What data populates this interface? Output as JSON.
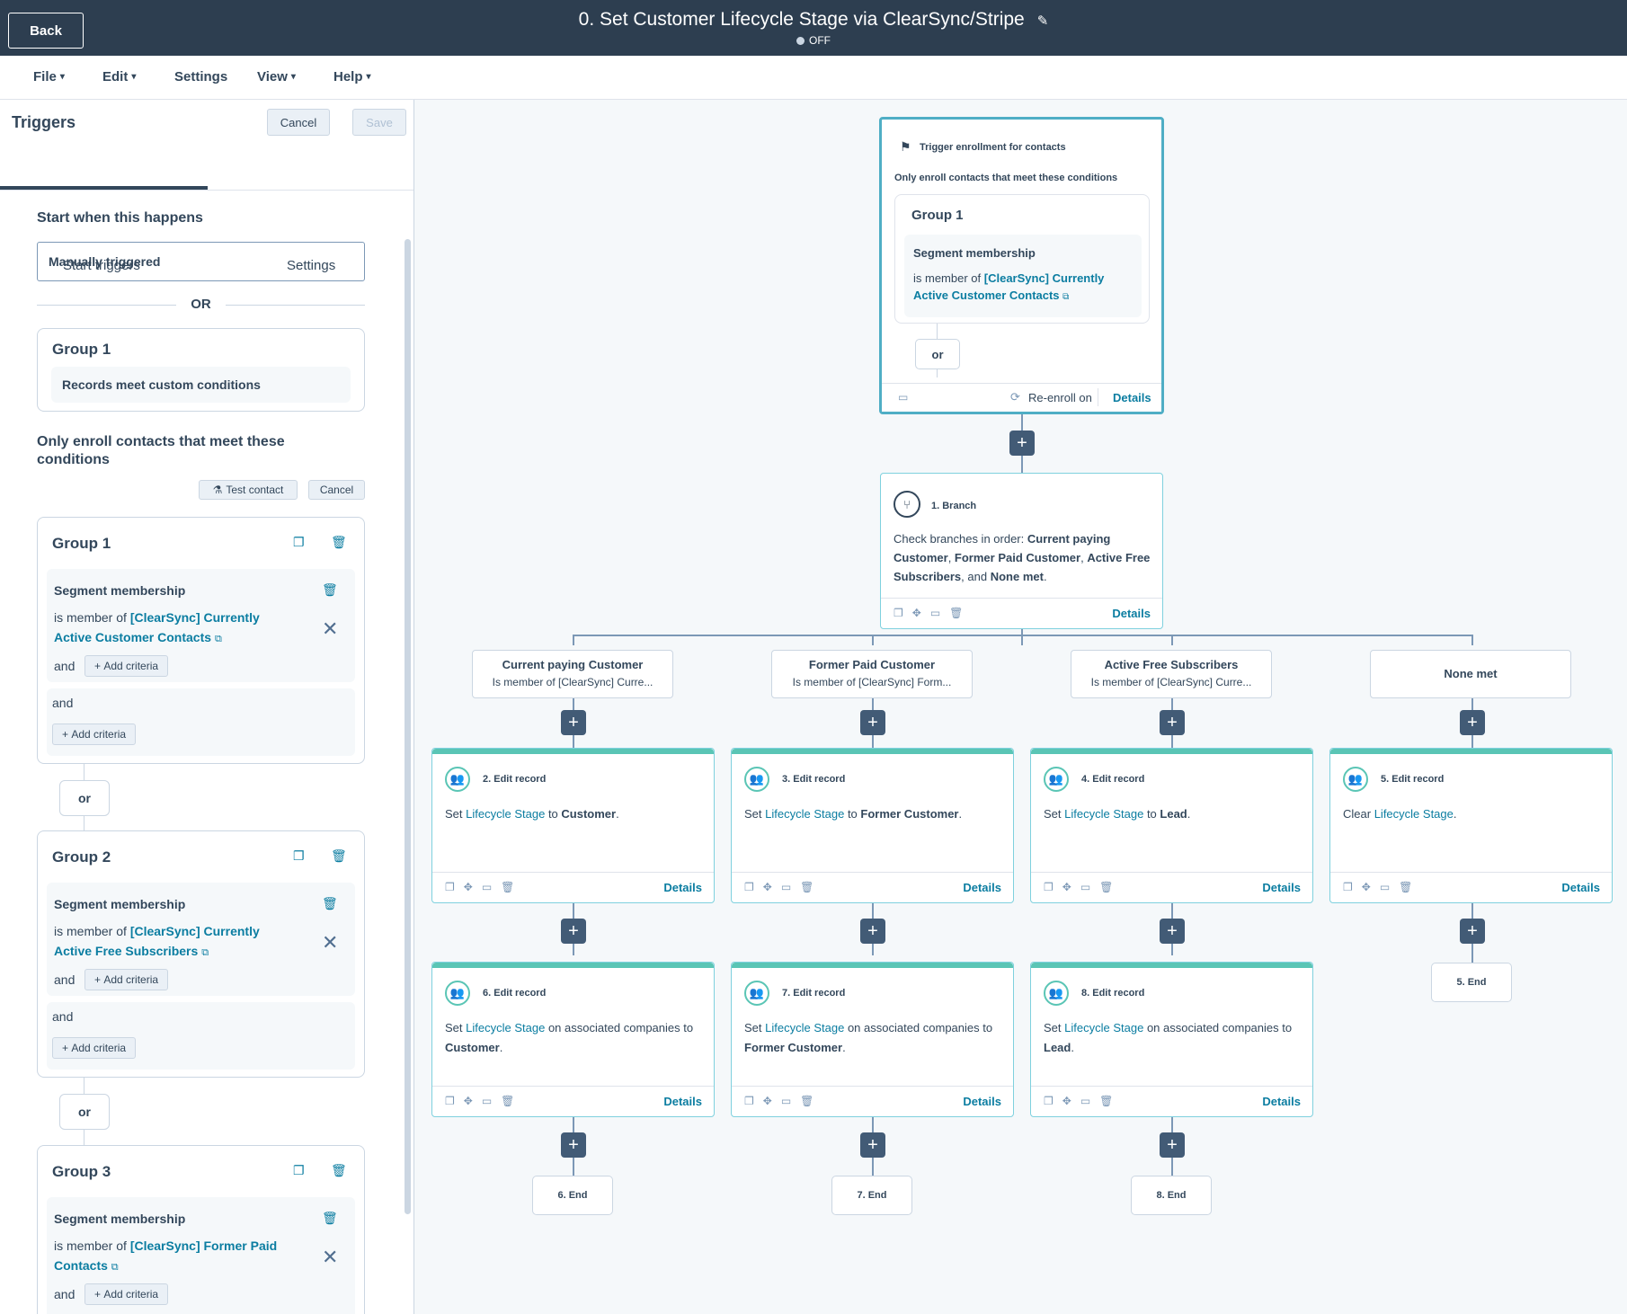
{
  "header": {
    "back_label": "Back",
    "title": "0. Set Customer Lifecycle Stage via ClearSync/Stripe",
    "status": "OFF"
  },
  "menu": {
    "file": "File",
    "edit": "Edit",
    "settings": "Settings",
    "view": "View",
    "help": "Help"
  },
  "left_panel": {
    "title": "Triggers",
    "cancel": "Cancel",
    "save": "Save",
    "tabs": [
      "Start triggers",
      "Settings"
    ],
    "start_when": "Start when this happens",
    "trigger_value": "Manually triggered",
    "or_text": "OR",
    "group1_top": {
      "title": "Group 1",
      "text": "Records meet custom conditions"
    },
    "only_enroll": "Only enroll contacts that meet these conditions",
    "test_contact": "Test contact",
    "cancel_small": "Cancel",
    "and": "and",
    "add_criteria": "Add criteria",
    "or_pill": "or",
    "groups": [
      {
        "title": "Group 1",
        "crit_title": "Segment membership",
        "prefix": "is member of",
        "link": "[ClearSync] Currently Active Customer Contacts"
      },
      {
        "title": "Group 2",
        "crit_title": "Segment membership",
        "prefix": "is member of",
        "link": "[ClearSync] Currently Active Free Subscribers"
      },
      {
        "title": "Group 3",
        "crit_title": "Segment membership",
        "prefix": "is member of",
        "link": "[ClearSync] Former Paid Contacts"
      }
    ]
  },
  "canvas": {
    "trigger": {
      "title": "Trigger enrollment for contacts",
      "subtitle": "Only enroll contacts that meet these conditions",
      "group": "Group 1",
      "crit_title": "Segment membership",
      "prefix": "is member of",
      "link": "[ClearSync] Currently Active Customer Contacts",
      "or": "or",
      "reenroll": "Re-enroll on",
      "details": "Details"
    },
    "branch": {
      "label": "1. Branch",
      "text_prefix": "Check branches in order:",
      "b1": "Current paying Customer",
      "b2": "Former Paid Customer",
      "b3": "Active Free Subscribers",
      "and": "and",
      "b4": "None met",
      "details": "Details"
    },
    "branches": [
      {
        "title": "Current paying Customer",
        "sub": "Is member of [ClearSync] Curre..."
      },
      {
        "title": "Former Paid Customer",
        "sub": "Is member of [ClearSync] Form..."
      },
      {
        "title": "Active Free Subscribers",
        "sub": "Is member of [ClearSync] Curre..."
      },
      {
        "title": "None met",
        "sub": ""
      }
    ],
    "edits_row1": [
      {
        "label": "2. Edit record",
        "pre": "Set",
        "prop": "Lifecycle Stage",
        "mid": "to",
        "val": "Customer"
      },
      {
        "label": "3. Edit record",
        "pre": "Set",
        "prop": "Lifecycle Stage",
        "mid": "to",
        "val": "Former Customer"
      },
      {
        "label": "4. Edit record",
        "pre": "Set",
        "prop": "Lifecycle Stage",
        "mid": "to",
        "val": "Lead"
      },
      {
        "label": "5. Edit record",
        "pre": "Clear",
        "prop": "Lifecycle Stage",
        "mid": "",
        "val": ""
      }
    ],
    "edits_row2": [
      {
        "label": "6. Edit record",
        "pre": "Set",
        "prop": "Lifecycle Stage",
        "mid": "on associated companies to",
        "val": "Customer"
      },
      {
        "label": "7. Edit record",
        "pre": "Set",
        "prop": "Lifecycle Stage",
        "mid": "on associated companies to",
        "val": "Former Customer"
      },
      {
        "label": "8. Edit record",
        "pre": "Set",
        "prop": "Lifecycle Stage",
        "mid": "on associated companies to",
        "val": "Lead"
      }
    ],
    "details": "Details",
    "ends": [
      "5. End",
      "6. End",
      "7. End",
      "8. End"
    ]
  }
}
